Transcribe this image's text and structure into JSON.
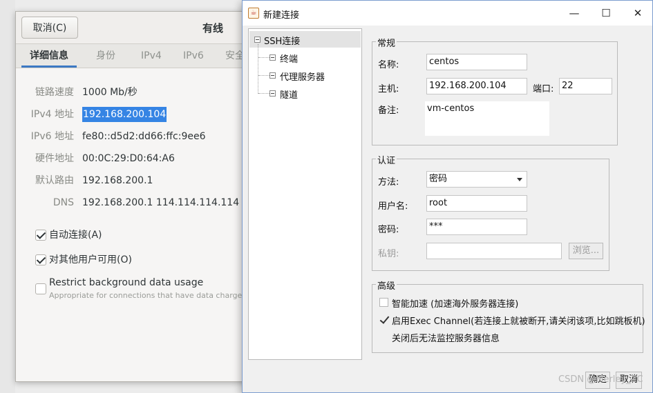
{
  "network_dialog": {
    "cancel_label": "取消(C)",
    "title": "有线",
    "tabs": [
      "详细信息",
      "身份",
      "IPv4",
      "IPv6",
      "安全"
    ],
    "details": [
      {
        "label": "链路速度",
        "value": "1000 Mb/秒"
      },
      {
        "label": "IPv4 地址",
        "value": "192.168.200.104"
      },
      {
        "label": "IPv6 地址",
        "value": "fe80::d5d2:dd66:ffc:9ee6"
      },
      {
        "label": "硬件地址",
        "value": "00:0C:29:D0:64:A6"
      },
      {
        "label": "默认路由",
        "value": "192.168.200.1"
      },
      {
        "label": "DNS",
        "value": "192.168.200.1 114.114.114.114"
      }
    ],
    "auto_connect_label": "自动连接(A)",
    "all_users_label": "对其他用户可用(O)",
    "restrict_label": "Restrict background data usage",
    "restrict_sub": "Appropriate for connections that have data charges or"
  },
  "new_connection": {
    "title": "新建连接",
    "window_buttons": {
      "minimize": "—",
      "maximize": "☐",
      "close": "✕"
    },
    "tree": {
      "root": "SSH连接",
      "children": [
        "终端",
        "代理服务器",
        "隧道"
      ]
    },
    "general": {
      "title": "常规",
      "name_label": "名称:",
      "name_value": "centos",
      "host_label": "主机:",
      "host_value": "192.168.200.104",
      "port_label": "端口:",
      "port_value": "22",
      "note_label": "备注:",
      "note_value": "vm-centos"
    },
    "auth": {
      "title": "认证",
      "method_label": "方法:",
      "method_value": "密码",
      "user_label": "用户名:",
      "user_value": "root",
      "password_label": "密码:",
      "password_value": "***",
      "key_label": "私钥:",
      "browse_label": "浏览..."
    },
    "advanced": {
      "title": "高级",
      "smart_accel_label": "智能加速 (加速海外服务器连接)",
      "exec_channel_label": "启用Exec Channel(若连接上就被断开,请关闭该项,比如跳板机)",
      "exec_channel_note": "关闭后无法监控服务器信息"
    },
    "ok_label": "确定",
    "cancel_label": "取消"
  },
  "watermark": "CSDN @Merley_ZC"
}
